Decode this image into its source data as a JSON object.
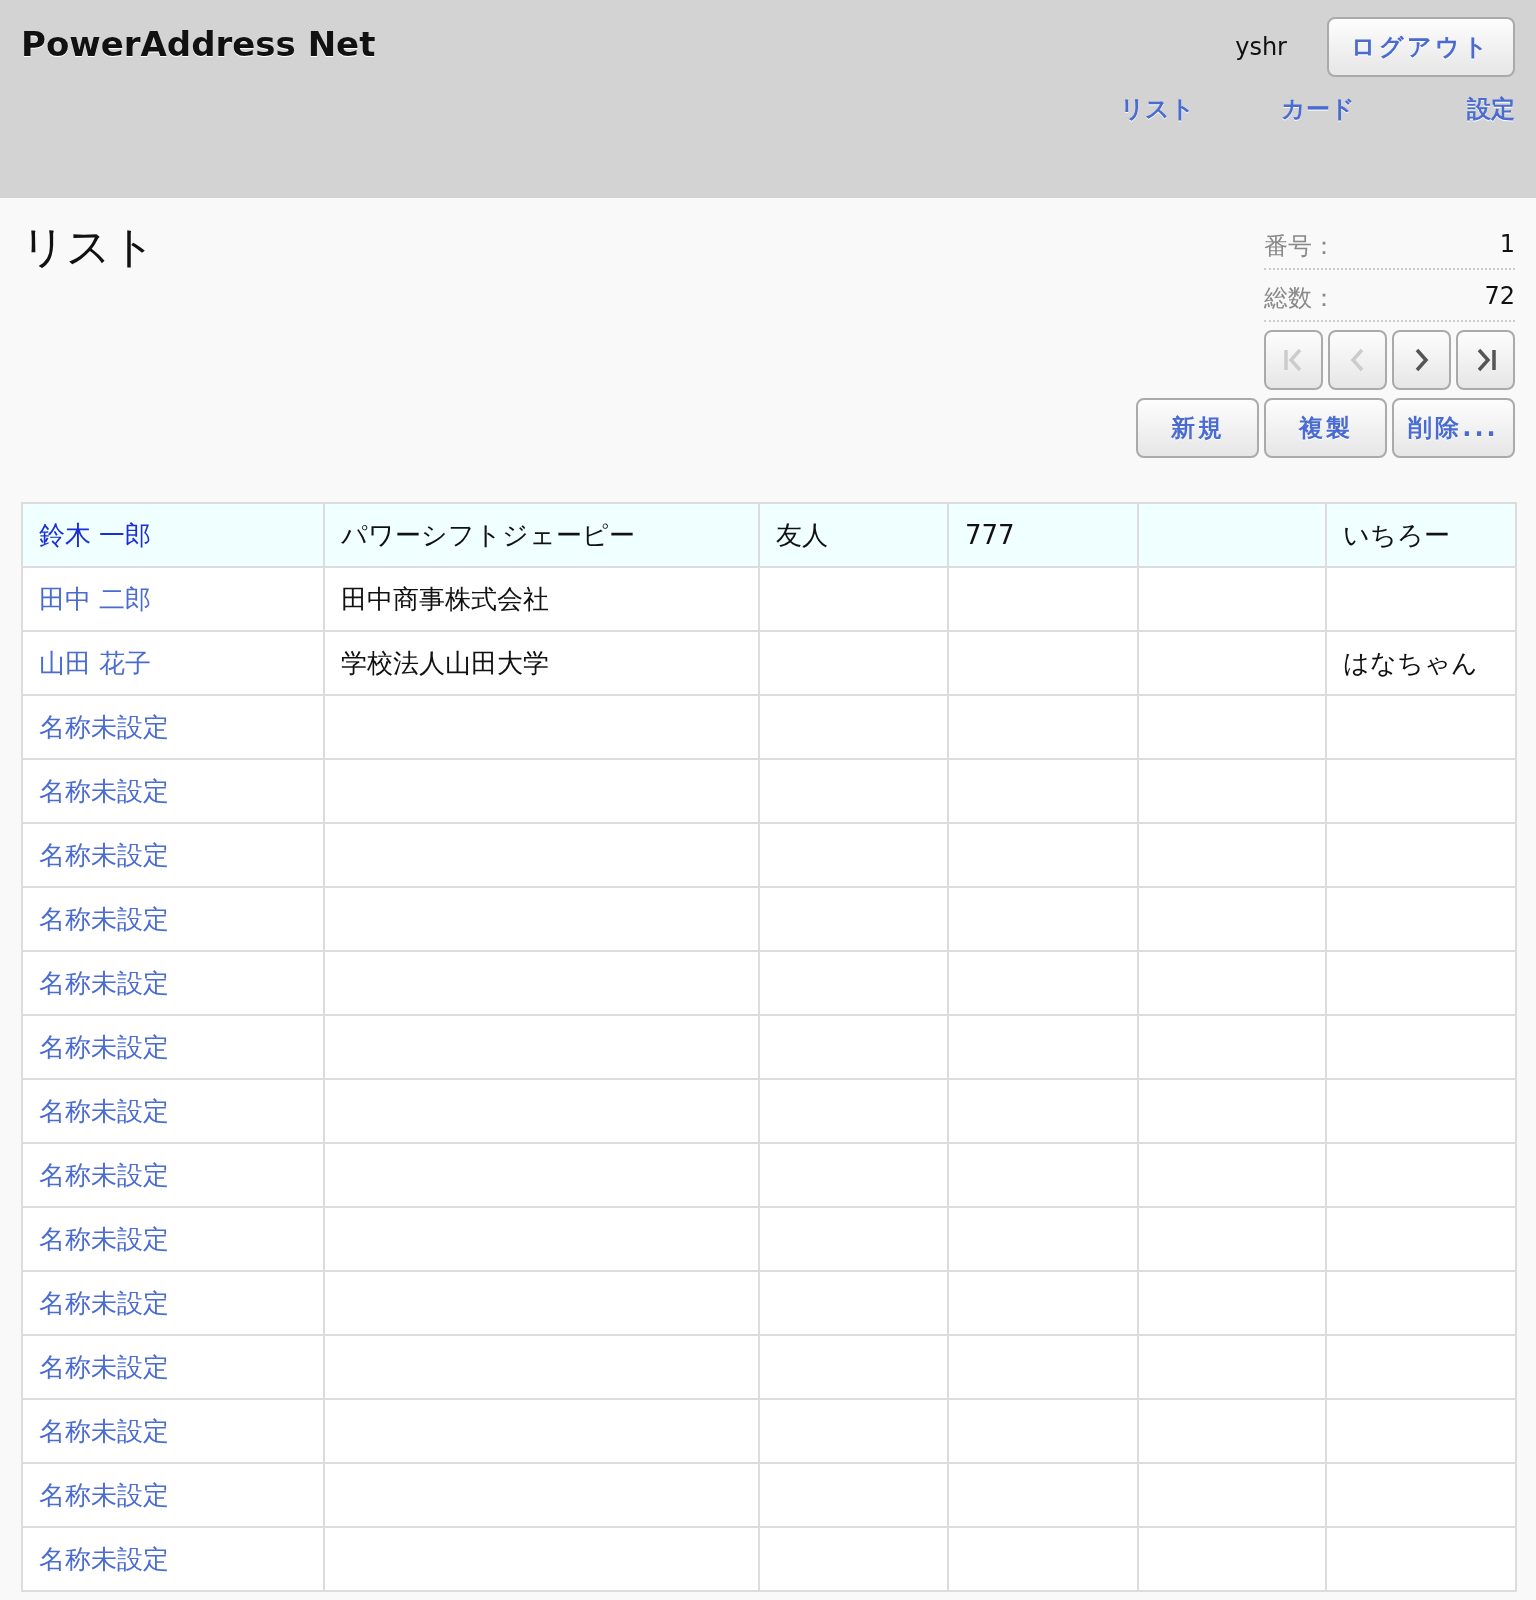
{
  "app_title": "PowerAddress Net",
  "user": "yshr",
  "logout_button": "ログアウト",
  "nav": [
    {
      "label": "リスト"
    },
    {
      "label": "カード"
    },
    {
      "label": "設定"
    }
  ],
  "page_title": "リスト",
  "record_info": [
    {
      "label": "番号：",
      "value": "1"
    },
    {
      "label": "総数：",
      "value": "72"
    }
  ],
  "pager": [
    {
      "kind": "first",
      "disabled": true
    },
    {
      "kind": "prev",
      "disabled": true
    },
    {
      "kind": "next",
      "disabled": false
    },
    {
      "kind": "last",
      "disabled": false
    }
  ],
  "actions": [
    "新規",
    "複製",
    "削除..."
  ],
  "table": {
    "rows": [
      {
        "selected": true,
        "cells": [
          "鈴木 一郎",
          "パワーシフトジェーピー",
          "友人",
          "777",
          "",
          "いちろー"
        ]
      },
      {
        "selected": false,
        "cells": [
          "田中 二郎",
          "田中商事株式会社",
          "",
          "",
          "",
          ""
        ]
      },
      {
        "selected": false,
        "cells": [
          "山田 花子",
          "学校法人山田大学",
          "",
          "",
          "",
          "はなちゃん"
        ]
      },
      {
        "selected": false,
        "cells": [
          "名称未設定",
          "",
          "",
          "",
          "",
          ""
        ]
      },
      {
        "selected": false,
        "cells": [
          "名称未設定",
          "",
          "",
          "",
          "",
          ""
        ]
      },
      {
        "selected": false,
        "cells": [
          "名称未設定",
          "",
          "",
          "",
          "",
          ""
        ]
      },
      {
        "selected": false,
        "cells": [
          "名称未設定",
          "",
          "",
          "",
          "",
          ""
        ]
      },
      {
        "selected": false,
        "cells": [
          "名称未設定",
          "",
          "",
          "",
          "",
          ""
        ]
      },
      {
        "selected": false,
        "cells": [
          "名称未設定",
          "",
          "",
          "",
          "",
          ""
        ]
      },
      {
        "selected": false,
        "cells": [
          "名称未設定",
          "",
          "",
          "",
          "",
          ""
        ]
      },
      {
        "selected": false,
        "cells": [
          "名称未設定",
          "",
          "",
          "",
          "",
          ""
        ]
      },
      {
        "selected": false,
        "cells": [
          "名称未設定",
          "",
          "",
          "",
          "",
          ""
        ]
      },
      {
        "selected": false,
        "cells": [
          "名称未設定",
          "",
          "",
          "",
          "",
          ""
        ]
      },
      {
        "selected": false,
        "cells": [
          "名称未設定",
          "",
          "",
          "",
          "",
          ""
        ]
      },
      {
        "selected": false,
        "cells": [
          "名称未設定",
          "",
          "",
          "",
          "",
          ""
        ]
      },
      {
        "selected": false,
        "cells": [
          "名称未設定",
          "",
          "",
          "",
          "",
          ""
        ]
      },
      {
        "selected": false,
        "cells": [
          "名称未設定",
          "",
          "",
          "",
          "",
          ""
        ]
      }
    ]
  }
}
